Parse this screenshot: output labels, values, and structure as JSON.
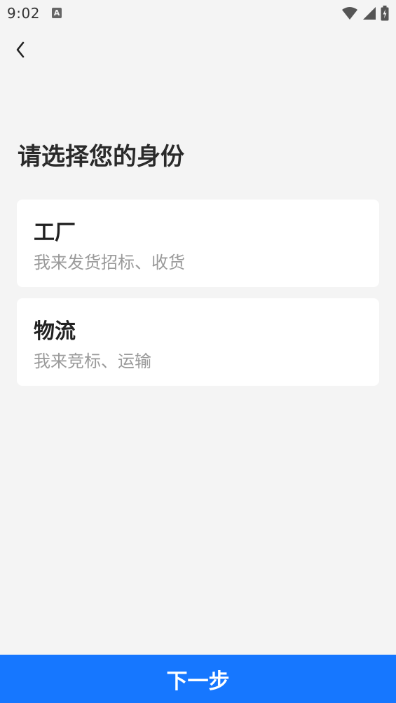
{
  "status_bar": {
    "time": "9:02",
    "notification_icon": "A",
    "icons": [
      "wifi-icon",
      "signal-icon",
      "battery-charging-icon"
    ]
  },
  "header": {
    "back_icon": "chevron-left-icon"
  },
  "page": {
    "title": "请选择您的身份"
  },
  "roles": [
    {
      "title": "工厂",
      "description": "我来发货招标、收货"
    },
    {
      "title": "物流",
      "description": "我来竞标、运输"
    }
  ],
  "footer": {
    "next_label": "下一步"
  },
  "colors": {
    "background": "#f4f4f4",
    "card": "#ffffff",
    "accent": "#1677ff",
    "secondary_text": "#9a9a9a"
  }
}
